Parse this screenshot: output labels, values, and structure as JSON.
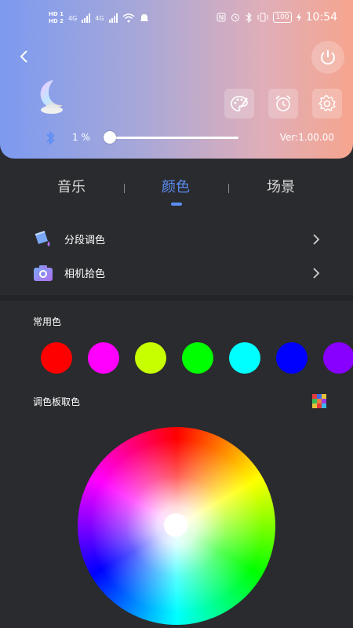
{
  "status_bar": {
    "network_hd_1": "HD",
    "network_hd_2": "HD",
    "net_1": "1",
    "net_2": "2",
    "sig_1": "4G",
    "sig_2": "4G",
    "battery": "100",
    "time": "10:54"
  },
  "header": {
    "bluetooth_percent": "1 %",
    "brightness_level": 0.01,
    "version": "Ver:1.00.00"
  },
  "tabs": [
    {
      "label": "音乐",
      "active": false
    },
    {
      "label": "颜色",
      "active": true
    },
    {
      "label": "场景",
      "active": false
    }
  ],
  "menu": [
    {
      "label": "分段调色",
      "icon": "paint-bucket-icon"
    },
    {
      "label": "相机拾色",
      "icon": "camera-icon"
    }
  ],
  "common_colors": {
    "title": "常用色",
    "swatches": [
      "#ff0000",
      "#ff00ff",
      "#c8ff00",
      "#00ff00",
      "#00ffff",
      "#0000ff",
      "#8800ff"
    ]
  },
  "palette": {
    "title": "调色板取色",
    "icon": "color-grid-icon"
  },
  "colors": {
    "accent": "#5a8df5",
    "background": "#2a2b2e"
  }
}
